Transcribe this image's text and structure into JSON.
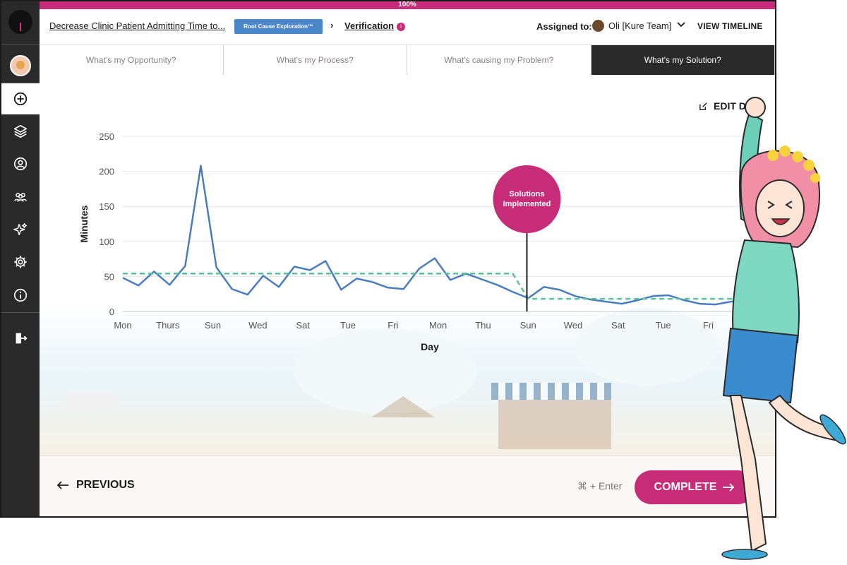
{
  "progress": {
    "label": "100%",
    "value": 1.0
  },
  "sidebar": {
    "items": [
      {
        "icon": "plus-circle-icon",
        "active": true
      },
      {
        "icon": "layers-icon"
      },
      {
        "icon": "user-icon"
      },
      {
        "icon": "team-icon"
      },
      {
        "icon": "sparkle-icon"
      },
      {
        "icon": "gear-icon"
      },
      {
        "icon": "info-icon"
      },
      {
        "icon": "logout-icon"
      }
    ]
  },
  "header": {
    "project_title": "Decrease Clinic Patient Admitting Time to...",
    "stage_badge": "Root Cause Exploration™",
    "separator": "›",
    "current_step": "Verification",
    "info_badge": "i",
    "assigned_label": "Assigned to:",
    "assignee": "Oli [Kure Team]",
    "view_timeline": "VIEW TIMELINE"
  },
  "tabs": [
    {
      "label": "What's my Opportunity?",
      "active": false
    },
    {
      "label": "What's my Process?",
      "active": false
    },
    {
      "label": "What's causing my Problem?",
      "active": false
    },
    {
      "label": "What's my Solution?",
      "active": true
    }
  ],
  "edit_data_label": "EDIT D",
  "chart_data": {
    "type": "line",
    "xlabel": "Day",
    "ylabel": "Minutes",
    "ylim": [
      0,
      250
    ],
    "yticks": [
      0,
      50,
      100,
      150,
      200,
      250
    ],
    "xticks": [
      "Mon",
      "Thurs",
      "Sun",
      "Wed",
      "Sat",
      "Tue",
      "Fri",
      "Mon",
      "Thu",
      "Sun",
      "Wed",
      "Sat",
      "Tue",
      "Fri"
    ],
    "series": [
      {
        "values": [
          48,
          37,
          57,
          38,
          65,
          208,
          63,
          32,
          24,
          51,
          35,
          64,
          59,
          72,
          31,
          47,
          42,
          34,
          32,
          61,
          76,
          45,
          54,
          46,
          38,
          28,
          19,
          35,
          31,
          22,
          17,
          14,
          11,
          16,
          22,
          23,
          16,
          11,
          10,
          14,
          17,
          16,
          20
        ],
        "color": "#4a7cc0"
      },
      {
        "values": [
          54,
          54,
          54,
          54,
          54,
          54,
          54,
          54,
          54,
          54,
          54,
          54,
          54,
          54,
          54,
          54,
          54,
          54,
          54,
          54,
          54,
          54,
          54,
          54,
          54,
          54,
          18,
          18,
          18,
          18,
          18,
          18,
          18,
          18,
          18,
          18,
          18,
          18,
          18,
          18,
          18,
          18,
          18
        ],
        "color": "#5cbf9a",
        "style": "dashed"
      }
    ],
    "annotations": [
      {
        "text": "Solutions Implemented",
        "x_index": 26,
        "color": "#c72c78"
      }
    ]
  },
  "footer": {
    "previous": "PREVIOUS",
    "shortcut_hint": "⌘ + Enter",
    "complete": "COMPLETE"
  }
}
